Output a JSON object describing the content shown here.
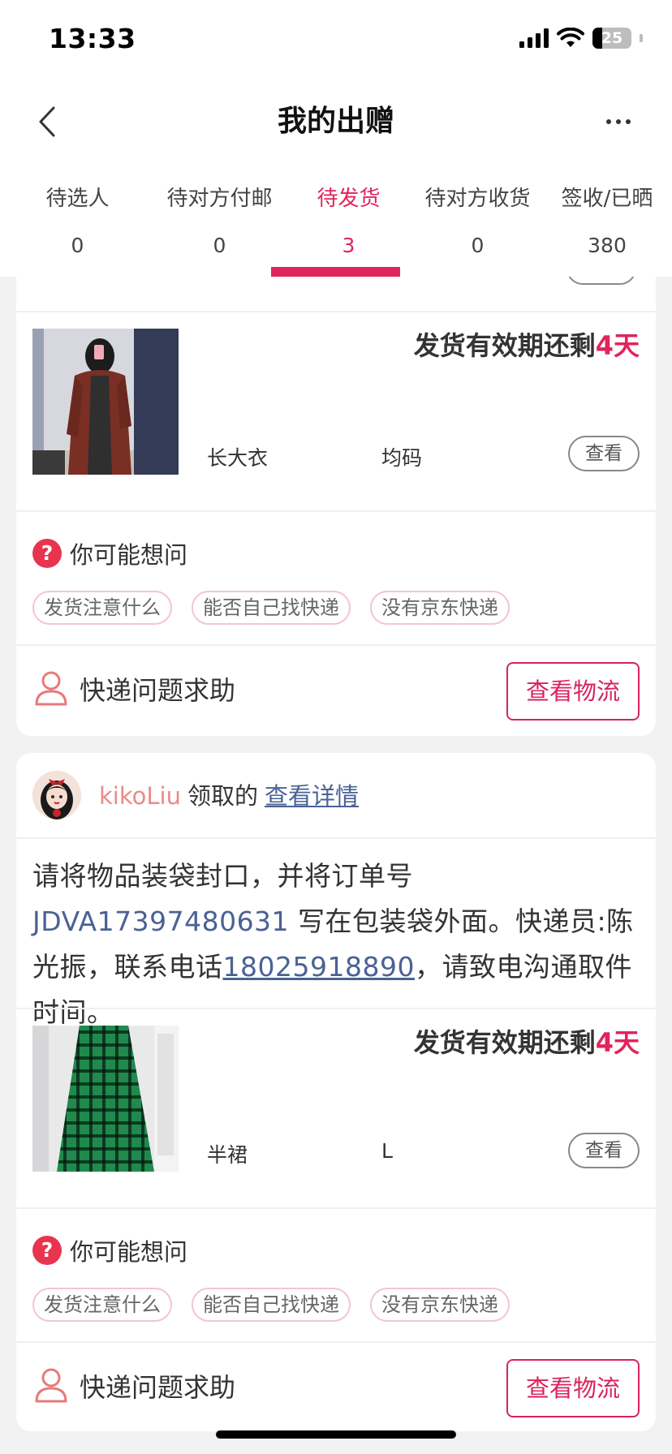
{
  "status_bar": {
    "time": "13:33",
    "battery": "25"
  },
  "header": {
    "title": "我的出赠"
  },
  "tabs": [
    {
      "label": "待选人",
      "count": "0",
      "active": false
    },
    {
      "label": "待对方付邮",
      "count": "0",
      "active": false
    },
    {
      "label": "待发货",
      "count": "3",
      "active": true
    },
    {
      "label": "待对方收货",
      "count": "0",
      "active": false
    },
    {
      "label": "签收/已晒",
      "count": "380",
      "active": false
    }
  ],
  "colors": {
    "accent": "#e0245e",
    "link": "#4a6294",
    "username": "#eb8a8a"
  },
  "cards": [
    {
      "deadline_prefix": "发货有效期还剩",
      "deadline_value": "4天",
      "item_name": "长大衣",
      "item_size": "均码",
      "view_label": "查看",
      "faq_title": "你可能想问",
      "faq_chips": [
        "发货注意什么",
        "能否自己找快递",
        "没有京东快递"
      ],
      "help_label": "快递问题求助",
      "logistics_label": "查看物流"
    },
    {
      "username": "kikoLiu",
      "claimed_text": "领取的",
      "detail_link": "查看详情",
      "instruction_1": "请将物品装袋封口，并将订单号 ",
      "order_no": "JDVA17397480631",
      "instruction_2": " 写在包装袋外面。快递员:陈光振，联系电话",
      "phone": "18025918890",
      "instruction_3": "，请致电沟通取件时间。",
      "deadline_prefix": "发货有效期还剩",
      "deadline_value": "4天",
      "item_name": "半裙",
      "item_size": "L",
      "view_label": "查看",
      "faq_title": "你可能想问",
      "faq_chips": [
        "发货注意什么",
        "能否自己找快递",
        "没有京东快递"
      ],
      "help_label": "快递问题求助",
      "logistics_label": "查看物流"
    }
  ]
}
